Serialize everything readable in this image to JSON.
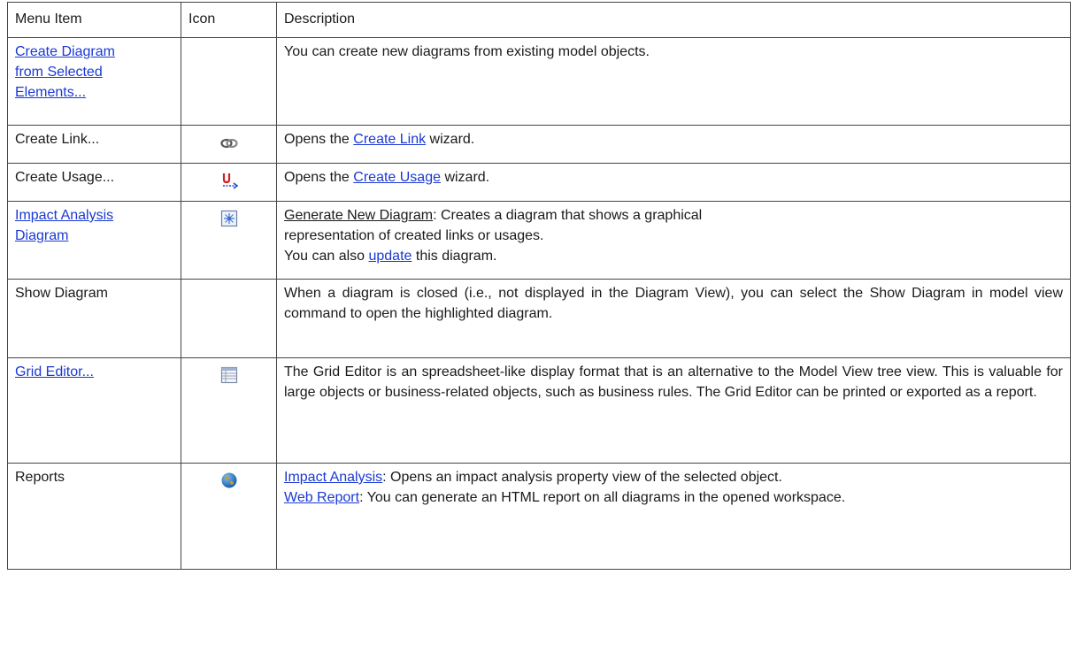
{
  "header": {
    "menu_item": "Menu Item",
    "icon": "Icon",
    "description": "Description"
  },
  "rows": [
    {
      "menu_item": "Create Diagram from Selected Elements...",
      "menu_lines": [
        "Create Diagram",
        "from Selected",
        "Elements..."
      ],
      "icon": "",
      "description": "You can create new diagrams from existing model objects."
    },
    {
      "menu_item": "Create Link...",
      "icon": "link-icon",
      "desc_pre": "Opens the ",
      "desc_link": "Create Link",
      "desc_post": " wizard."
    },
    {
      "menu_item": "Create Usage...",
      "icon": "usage-icon",
      "desc_pre": "Opens the ",
      "desc_link": "Create Usage",
      "desc_post": " wizard."
    },
    {
      "menu_item": "Impact Analysis Diagram",
      "menu_lines": [
        "Impact Analysis",
        "Diagram"
      ],
      "icon": "impact-diagram-icon",
      "desc_u": "Generate New Diagram",
      "desc_line1": ": Creates a diagram that shows a graphical",
      "desc_line2": "representation of created links or usages.",
      "desc_line3_pre": "You can also ",
      "desc_line3_link": "update",
      "desc_line3_post": " this diagram."
    },
    {
      "menu_item": "Show Diagram",
      "icon": "",
      "description": "When a diagram is closed (i.e., not displayed in the Diagram View), you can select the Show Diagram in model view command to open the highlighted diagram."
    },
    {
      "menu_item": "Grid Editor...",
      "icon": "grid-editor-icon",
      "description": "The Grid Editor is an spreadsheet-like display format that is an alternative to the Model View tree view. This is valuable for large objects or business-related objects, such as business rules. The Grid Editor can be printed or exported as a report."
    },
    {
      "menu_item": "Reports",
      "icon": "globe-icon",
      "desc_link1": "Impact Analysis",
      "desc_text1": ": Opens an impact analysis property view of the selected object.",
      "desc_link2": "Web Report",
      "desc_text2": ": You can generate an HTML report on all diagrams in the opened workspace."
    }
  ],
  "colors": {
    "link": "#1a39d4",
    "border": "#444444"
  }
}
